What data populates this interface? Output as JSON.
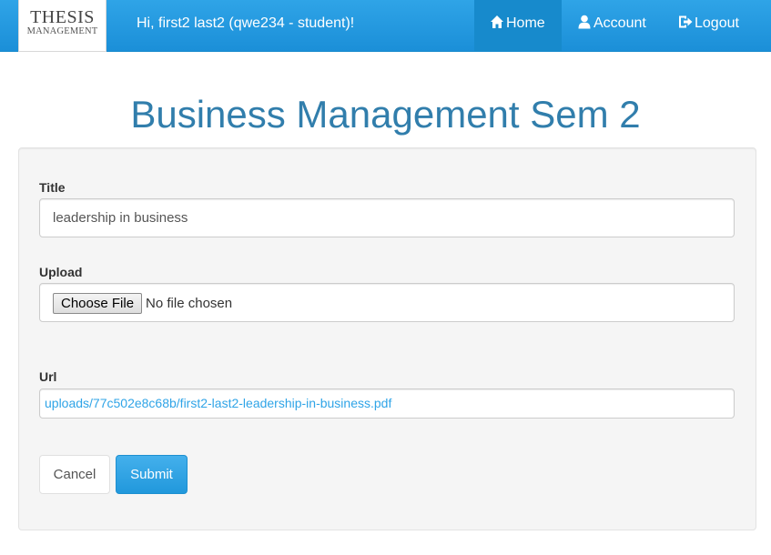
{
  "brand": {
    "line1": "THESIS",
    "line2": "MANAGEMENT"
  },
  "header": {
    "greeting": "Hi, first2 last2 (qwe234 - student)!",
    "nav": [
      {
        "label": "Home",
        "icon": "home-icon",
        "active": true
      },
      {
        "label": "Account",
        "icon": "user-icon",
        "active": false
      },
      {
        "label": "Logout",
        "icon": "logout-icon",
        "active": false
      }
    ]
  },
  "page": {
    "title": "Business Management Sem 2"
  },
  "form": {
    "title_label": "Title",
    "title_value": "leadership in business",
    "upload_label": "Upload",
    "upload_button": "Choose File",
    "upload_status": "No file chosen",
    "url_label": "Url",
    "url_value": "uploads/77c502e8c68b/first2-last2-leadership-in-business.pdf",
    "cancel_label": "Cancel",
    "submit_label": "Submit"
  },
  "colors": {
    "navbar": "#2fa4e7",
    "title": "#317eac",
    "link": "#2fa4e7"
  }
}
